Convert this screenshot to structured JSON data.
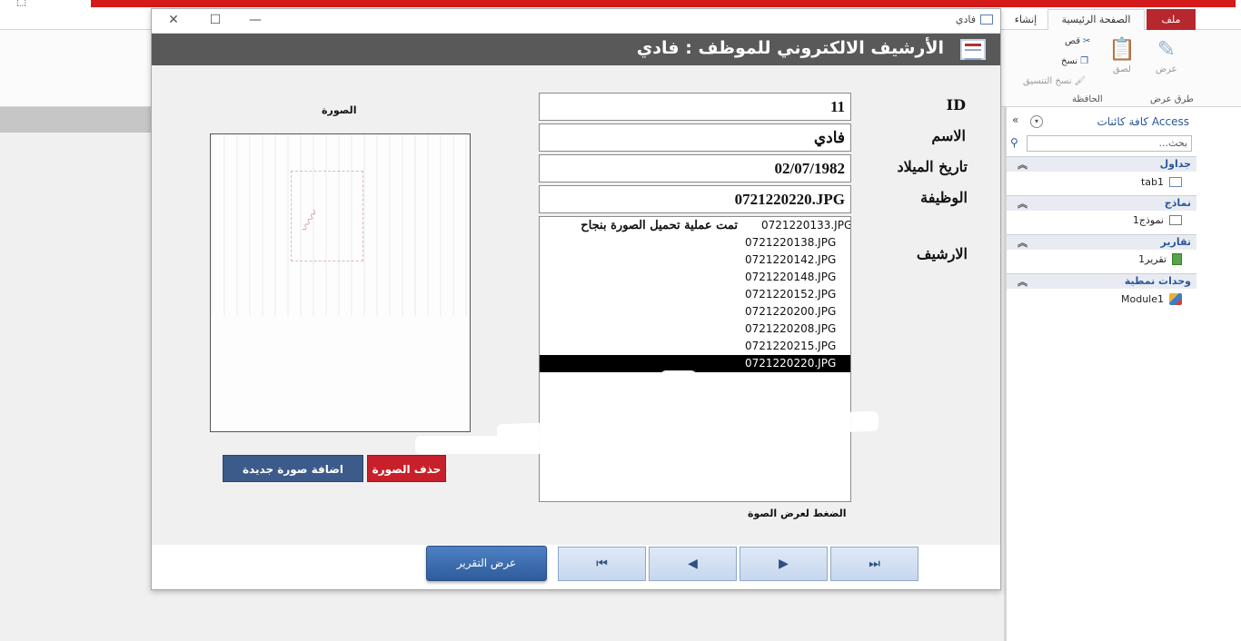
{
  "window": {
    "title_strip_text": "",
    "top_glyph": "⬚"
  },
  "ribbon": {
    "tabs": {
      "file": "ملف",
      "home": "الصفحة الرئيسية",
      "create": "إنشاء"
    },
    "groups": {
      "views": "طرق عرض",
      "clipboard": "الحافظة"
    },
    "buttons": {
      "view": "عرض",
      "paste": "لصق",
      "cut": "قص",
      "copy": "نسخ",
      "format_painter": "نسخ التنسيق"
    }
  },
  "nav_pane": {
    "title": "كافة كائنات Access",
    "search_placeholder": "بحث...",
    "sections": [
      {
        "label": "جداول",
        "items": [
          "tab1"
        ]
      },
      {
        "label": "نماذج",
        "items": [
          "نموذج1"
        ]
      },
      {
        "label": "تقارير",
        "items": [
          "تقرير1"
        ]
      },
      {
        "label": "وحدات نمطية",
        "items": [
          "Module1"
        ]
      }
    ]
  },
  "form_window": {
    "tab_name": "فادي",
    "header_title": "الأرشيف الالكتروني للموظف : فادي",
    "fields": {
      "id_label": "ID",
      "id_value": "11",
      "name_label": "الاسم",
      "name_value": "فادي",
      "dob_label": "تاريخ الميلاد",
      "dob_value": "02/07/1982",
      "job_label": "الوظيفة",
      "job_value": "0721220220.JPG",
      "archive_label": "الارشيف"
    },
    "archive": {
      "message": "تمت عملية تحميل الصورة بنجاح",
      "files": [
        "0721220133.JPG",
        "0721220138.JPG",
        "0721220142.JPG",
        "0721220148.JPG",
        "0721220152.JPG",
        "0721220200.JPG",
        "0721220208.JPG",
        "0721220215.JPG",
        "0721220220.JPG"
      ],
      "selected": "0721220220.JPG",
      "hint": "الضغط لعرض الصوة"
    },
    "photo": {
      "label": "الصورة"
    },
    "buttons": {
      "add_photo": "اضافة صورة جديدة",
      "delete_photo": "حذف الصورة",
      "show_report": "عرض التقرير"
    },
    "record_nav": {
      "first": "⏮",
      "prev": "◀",
      "next": "▶",
      "last": "⏭"
    }
  }
}
